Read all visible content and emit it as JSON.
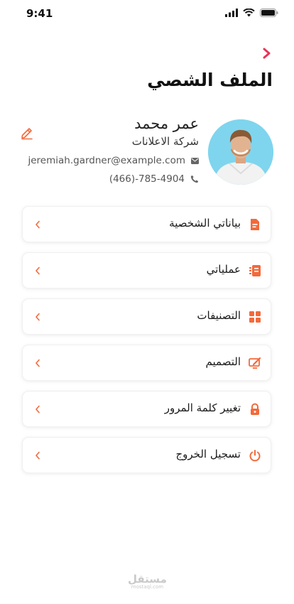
{
  "status_bar": {
    "time": "9:41"
  },
  "header": {
    "title": "الملف الشصي"
  },
  "profile": {
    "name": "عمر محمد",
    "company": "شركة الاعلانات",
    "email": "jeremiah.gardner@example.com",
    "phone": "(466)-785-4904"
  },
  "menu": {
    "items": [
      {
        "label": "بياناتي الشخصية",
        "icon": "document-icon"
      },
      {
        "label": "عملياتي",
        "icon": "clipboard-icon"
      },
      {
        "label": "التصنيفات",
        "icon": "grid-icon"
      },
      {
        "label": "التصميم",
        "icon": "design-monitor-icon"
      },
      {
        "label": "تغيير كلمة المرور",
        "icon": "lock-icon"
      },
      {
        "label": "تسجيل الخروج",
        "icon": "power-icon"
      }
    ]
  },
  "watermark": {
    "arabic": "مستقل",
    "latin": "mostaql.com"
  },
  "colors": {
    "accent": "#f26a3b",
    "back_arrow": "#e8335a",
    "avatar_bg": "#7fd5ee"
  }
}
